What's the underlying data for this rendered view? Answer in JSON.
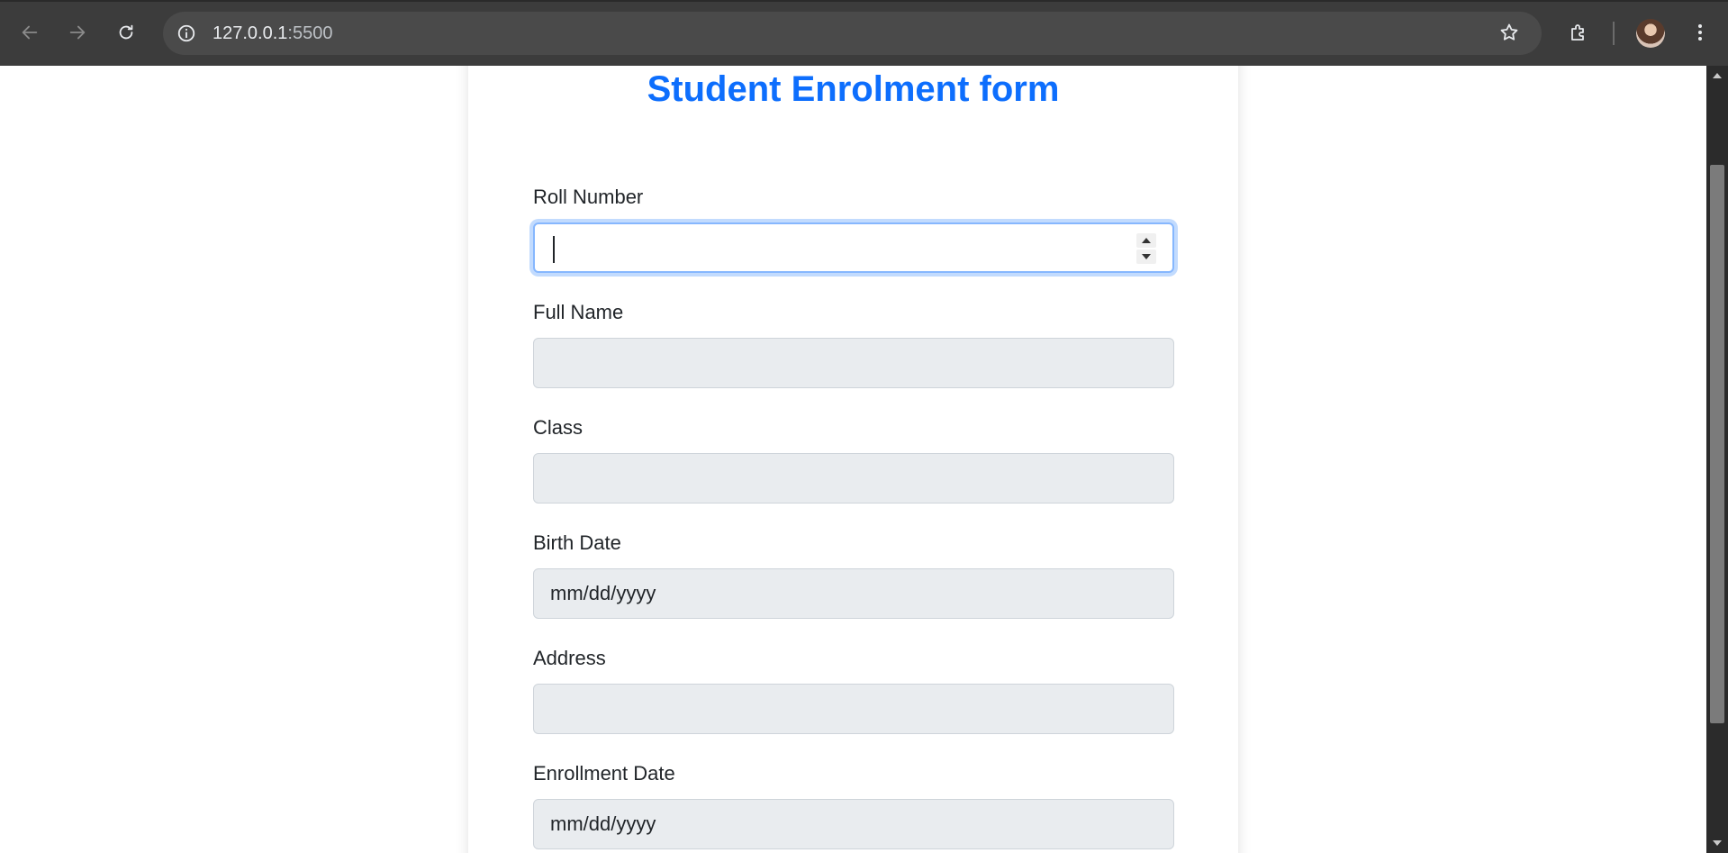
{
  "browser": {
    "url_host": "127.0.0.1",
    "url_port": ":5500",
    "back_icon": "arrow-left-icon",
    "forward_icon": "arrow-right-icon",
    "reload_icon": "reload-icon",
    "info_icon": "info-icon",
    "bookmark_icon": "star-icon",
    "extensions_icon": "puzzle-icon",
    "menu_icon": "kebab-menu-icon"
  },
  "form": {
    "title": "Student Enrolment form",
    "title_color": "#0d6efd",
    "fields": [
      {
        "label": "Roll Number",
        "type": "number",
        "value": "",
        "placeholder": "",
        "focused": true
      },
      {
        "label": "Full Name",
        "type": "text",
        "value": "",
        "placeholder": ""
      },
      {
        "label": "Class",
        "type": "text",
        "value": "",
        "placeholder": ""
      },
      {
        "label": "Birth Date",
        "type": "date",
        "value": "",
        "placeholder": "mm/dd/yyyy"
      },
      {
        "label": "Address",
        "type": "text",
        "value": "",
        "placeholder": ""
      },
      {
        "label": "Enrollment Date",
        "type": "date",
        "value": "",
        "placeholder": "mm/dd/yyyy"
      }
    ]
  }
}
